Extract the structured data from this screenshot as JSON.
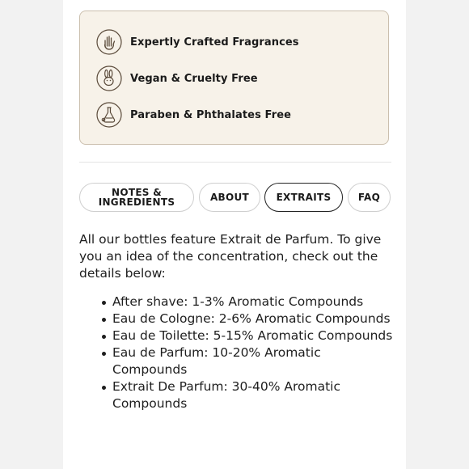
{
  "features": [
    {
      "label": "Expertly Crafted Fragrances",
      "icon": "hand-icon"
    },
    {
      "label": "Vegan & Cruelty Free",
      "icon": "rabbit-icon"
    },
    {
      "label": "Paraben & Phthalates Free",
      "icon": "flask-icon"
    }
  ],
  "tabs": {
    "notes_line1": "NOTES &",
    "notes_line2": "INGREDIENTS",
    "about": "ABOUT",
    "extraits": "EXTRAITS",
    "faq": "FAQ",
    "active": "EXTRAITS"
  },
  "content": {
    "intro": "All our bottles feature Extrait de Parfum. To give you an idea of the concentration, check out the details below:",
    "items": [
      "After shave: 1-3% Aromatic Compounds",
      "Eau de Cologne: 2-6% Aromatic Compounds",
      "Eau de Toilette: 5-15% Aromatic Compounds",
      "Eau de Parfum: 10-20% Aromatic Compounds",
      "Extrait De Parfum: 30-40% Aromatic Compounds"
    ]
  },
  "colors": {
    "feature_box_bg": "#f7f2e9",
    "feature_box_border": "#cbbfae",
    "icon_stroke": "#5a4a3a"
  }
}
